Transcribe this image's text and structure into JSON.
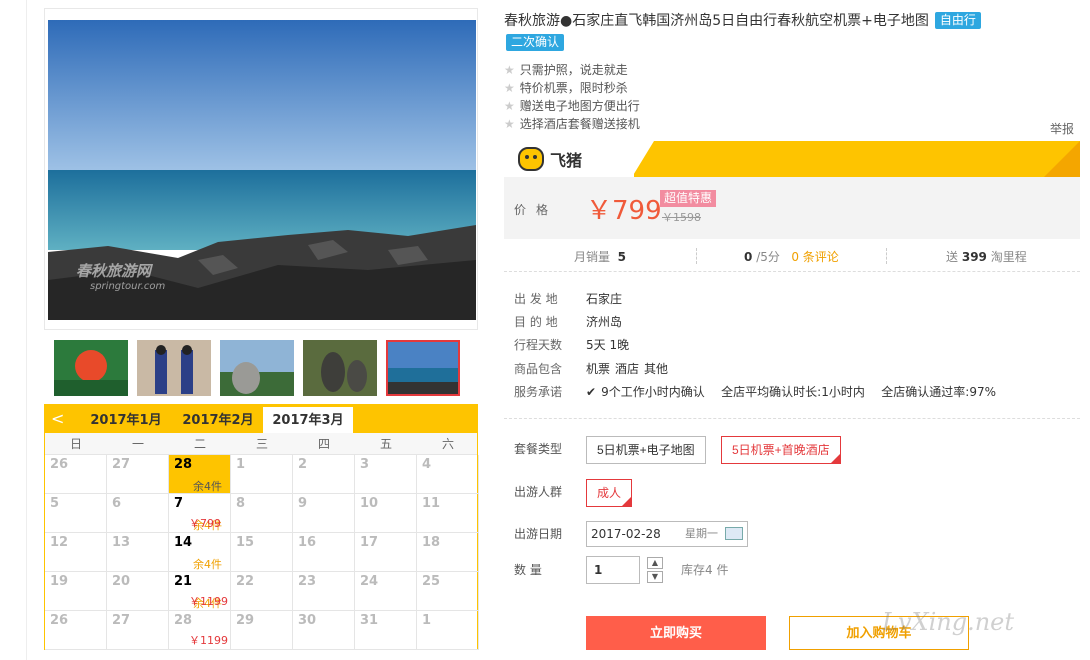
{
  "product": {
    "title": "春秋旅游●石家庄直飞韩国济州岛5日自由行春秋航空机票+电子地图",
    "badge_type": "自由行",
    "badge_confirm": "二次确认",
    "features": [
      "只需护照，说走就走",
      "特价机票，限时秒杀",
      "赠送电子地图方便出行",
      "选择酒店套餐赠送接机"
    ],
    "report": "举报",
    "photo_watermark": "春秋旅游网",
    "photo_watermark_sub": "springtour.com"
  },
  "brand": {
    "name": "飞猪",
    "accent": "#fec400"
  },
  "price": {
    "label": "价格",
    "current": "￥799",
    "tag": "超值特惠",
    "original": "￥1598"
  },
  "stats": {
    "monthly_label": "月销量",
    "monthly_value": "5",
    "rating": "0",
    "rating_suffix": "/5分",
    "reviews": "0 条评论",
    "miles_prefix": "送",
    "miles_value": "399",
    "miles_suffix": "淘里程"
  },
  "info": [
    {
      "k": "出 发 地",
      "v": "石家庄"
    },
    {
      "k": "目 的 地",
      "v": "济州岛"
    },
    {
      "k": "行程天数",
      "v": "5天 1晚"
    },
    {
      "k": "商品包含",
      "items": [
        "机票",
        "酒店",
        "其他"
      ]
    },
    {
      "k": "服务承诺",
      "items": [
        "9个工作小时内确认",
        "全店平均确认时长:1小时内",
        "全店确认通过率:97%"
      ]
    }
  ],
  "options": {
    "package_label": "套餐类型",
    "packages": [
      "5日机票+电子地图",
      "5日机票+首晚酒店"
    ],
    "group_label": "出游人群",
    "group": "成人",
    "date_label": "出游日期",
    "date": "2017-02-28",
    "weekday": "星期一",
    "qty_label": "数 量",
    "qty": "1",
    "stock": "库存4 件",
    "buy": "立即购买",
    "cart": "加入购物车"
  },
  "calendar": {
    "prev": "<",
    "tabs": [
      "2017年1月",
      "2017年2月",
      "2017年3月"
    ],
    "weekdays": [
      "日",
      "一",
      "二",
      "三",
      "四",
      "五",
      "六"
    ],
    "rows": [
      [
        {
          "d": "26"
        },
        {
          "d": "27"
        },
        {
          "d": "28",
          "on": true,
          "today": true,
          "stock": "余4件"
        },
        {
          "d": "1"
        },
        {
          "d": "2"
        },
        {
          "d": "3"
        },
        {
          "d": "4"
        }
      ],
      [
        {
          "d": "5"
        },
        {
          "d": "6"
        },
        {
          "d": "7",
          "on": true,
          "stock": "余4件",
          "price": "￥799"
        },
        {
          "d": "8"
        },
        {
          "d": "9"
        },
        {
          "d": "10"
        },
        {
          "d": "11"
        }
      ],
      [
        {
          "d": "12"
        },
        {
          "d": "13"
        },
        {
          "d": "14",
          "on": true,
          "stock": "余4件"
        },
        {
          "d": "15"
        },
        {
          "d": "16"
        },
        {
          "d": "17"
        },
        {
          "d": "18"
        }
      ],
      [
        {
          "d": "19"
        },
        {
          "d": "20"
        },
        {
          "d": "21",
          "on": true,
          "stock": "余4件",
          "price": "￥1199"
        },
        {
          "d": "22"
        },
        {
          "d": "23"
        },
        {
          "d": "24"
        },
        {
          "d": "25"
        }
      ],
      [
        {
          "d": "26"
        },
        {
          "d": "27"
        },
        {
          "d": "28",
          "price": "￥1199"
        },
        {
          "d": "29"
        },
        {
          "d": "30"
        },
        {
          "d": "31"
        },
        {
          "d": "1"
        }
      ]
    ]
  },
  "site_watermark": "LvXing.net"
}
